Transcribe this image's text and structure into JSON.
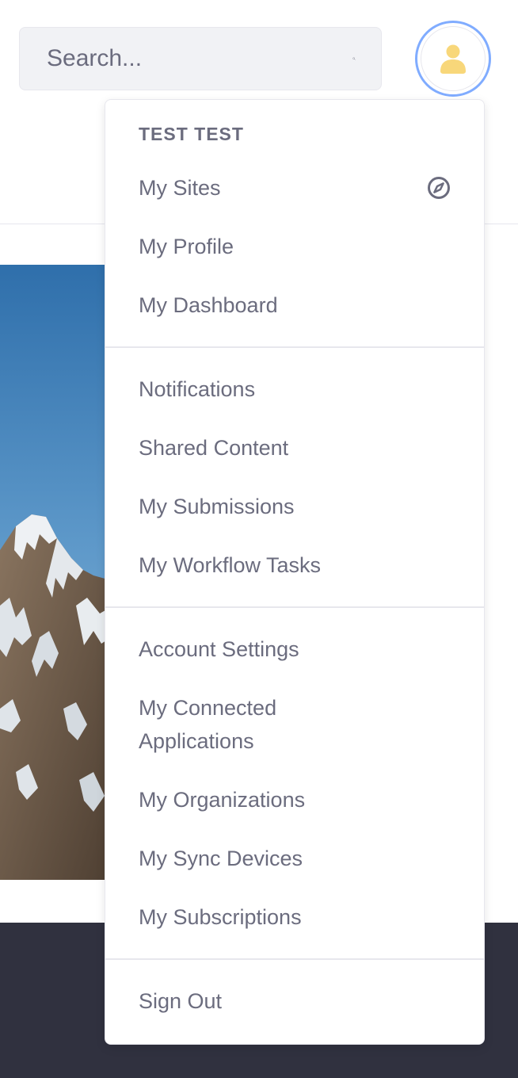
{
  "search": {
    "placeholder": "Search...",
    "icon": "search-icon"
  },
  "user": {
    "avatar_icon": "user-icon",
    "avatar_color": "#f8d77a",
    "ring_color": "#80acff"
  },
  "menu": {
    "header": "TEST TEST",
    "sites_icon": "compass-icon",
    "items": {
      "my_sites": "My Sites",
      "my_profile": "My Profile",
      "my_dashboard": "My Dashboard",
      "notifications": "Notifications",
      "shared_content": "Shared Content",
      "my_submissions": "My Submissions",
      "my_workflow_tasks": "My Workflow Tasks",
      "account_settings": "Account Settings",
      "my_connected_applications": "My Connected Applications",
      "my_organizations": "My Organizations",
      "my_sync_devices": "My Sync Devices",
      "my_subscriptions": "My Subscriptions",
      "sign_out": "Sign Out"
    }
  },
  "colors": {
    "text": "#6b6c7e",
    "divider": "#e7e7ed",
    "footer": "#30313f",
    "search_bg": "#f1f2f5"
  }
}
